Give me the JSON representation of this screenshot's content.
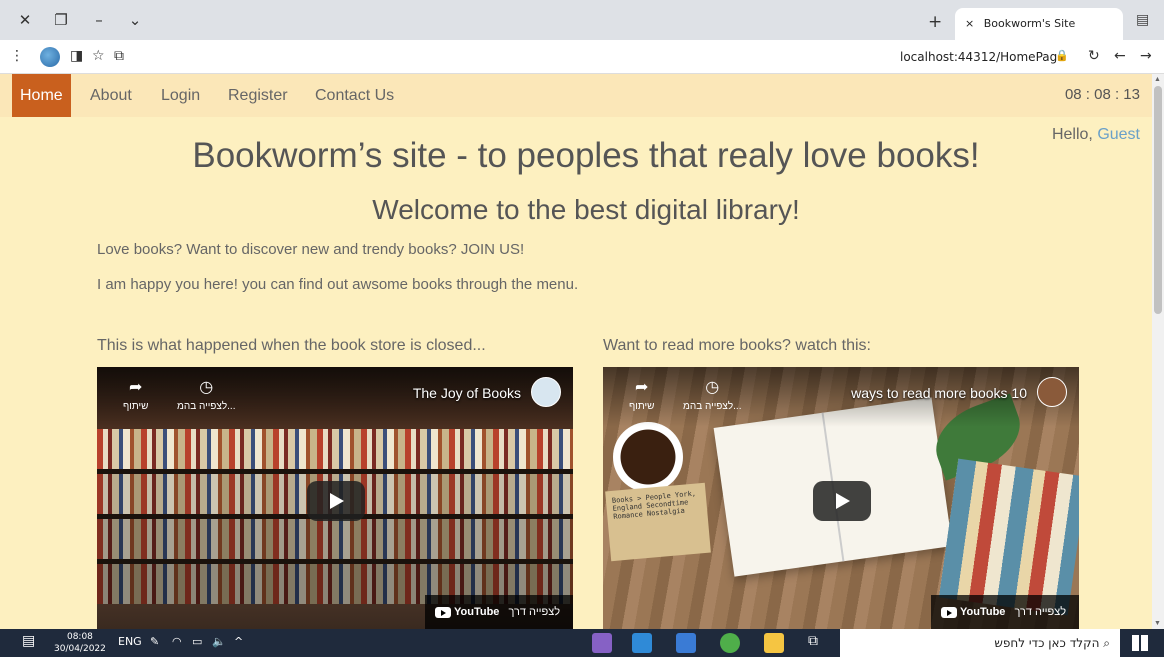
{
  "browser": {
    "tab_title": "Bookworm's Site",
    "tab_close": "×",
    "new_tab": "+",
    "url": "localhost:44312/HomePage",
    "win_close": "✕",
    "win_restore": "❐",
    "win_min": "–",
    "win_dropdown": "⌄"
  },
  "nav": {
    "items": [
      "Home",
      "About",
      "Login",
      "Register",
      "Contact Us"
    ],
    "active": "Home",
    "clock": "08 : 08 : 13"
  },
  "greeting": {
    "hello": "Hello, ",
    "user": "Guest"
  },
  "main": {
    "title": "Bookworm’s site - to peoples that realy love books!",
    "subtitle": "Welcome to the best digital library!",
    "line1": "Love books? Want to discover new and trendy books? JOIN US!",
    "line2": "I am happy you here! you can find out awsome books through the menu."
  },
  "videos": [
    {
      "caption": "This is what happened when the book store is closed...",
      "title": "The Joy of Books",
      "share_label": "שיתוף",
      "watch_later_label": "לצפייה בהמ...",
      "watch_on": "לצפייה דרך",
      "brand": "YouTube"
    },
    {
      "caption": "Want to read more books? watch this:",
      "title": "ways to read more books 10",
      "share_label": "שיתוף",
      "watch_later_label": "לצפייה בהמ...",
      "watch_on": "לצפייה דרך",
      "brand": "YouTube",
      "tag_text": "Books > People York, England Secondtime Romance Nostalgia"
    }
  ],
  "taskbar": {
    "time": "08:08",
    "date": "30/04/2022",
    "lang": "ENG",
    "search_placeholder": "הקלד כאן כדי לחפש"
  },
  "colors": {
    "page_bg": "#fdf0c0",
    "nav_bg": "#fbe7b8",
    "nav_active": "#c9601e",
    "guest_link": "#6aa0c8",
    "taskbar": "#1f2a3c"
  }
}
